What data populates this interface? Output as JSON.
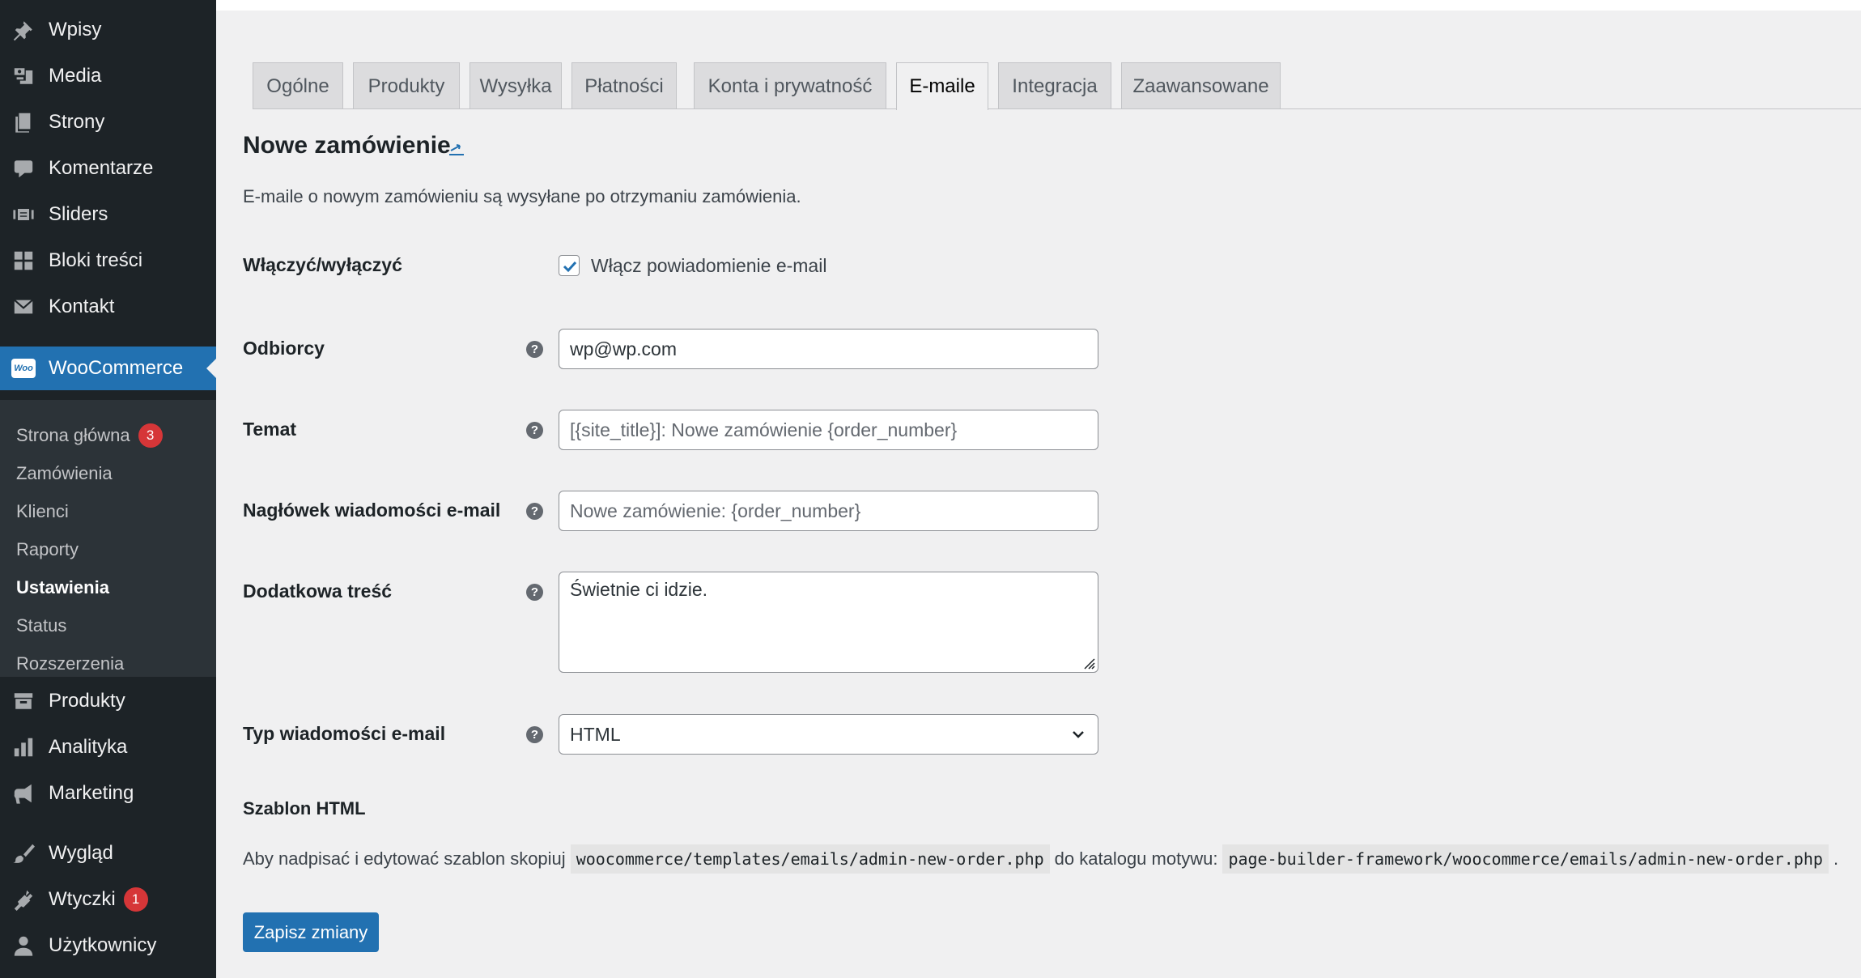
{
  "sidebar": {
    "top_items": [
      {
        "label": "Wpisy",
        "icon": "pin-icon"
      },
      {
        "label": "Media",
        "icon": "media-icon"
      },
      {
        "label": "Strony",
        "icon": "pages-icon"
      },
      {
        "label": "Komentarze",
        "icon": "comment-icon"
      },
      {
        "label": "Sliders",
        "icon": "slider-icon"
      },
      {
        "label": "Bloki treści",
        "icon": "blocks-icon"
      },
      {
        "label": "Kontakt",
        "icon": "mail-icon"
      }
    ],
    "woocommerce": {
      "label": "WooCommerce",
      "icon": "woocommerce-icon",
      "logo_text": "Woo"
    },
    "submenu": [
      {
        "label": "Strona główna",
        "badge": "3"
      },
      {
        "label": "Zamówienia"
      },
      {
        "label": "Klienci"
      },
      {
        "label": "Raporty"
      },
      {
        "label": "Ustawienia"
      },
      {
        "label": "Status"
      },
      {
        "label": "Rozszerzenia"
      }
    ],
    "bottom_items": [
      {
        "label": "Produkty",
        "icon": "archive-icon"
      },
      {
        "label": "Analityka",
        "icon": "bar-chart-icon"
      },
      {
        "label": "Marketing",
        "icon": "megaphone-icon"
      },
      {
        "label": "Wygląd",
        "icon": "brush-icon"
      },
      {
        "label": "Wtyczki",
        "icon": "plugin-icon",
        "badge": "1"
      },
      {
        "label": "Użytkownicy",
        "icon": "user-icon"
      }
    ]
  },
  "tabs": [
    {
      "label": "Ogólne"
    },
    {
      "label": "Produkty"
    },
    {
      "label": "Wysyłka"
    },
    {
      "label": "Płatności"
    },
    {
      "label": "Konta i prywatność"
    },
    {
      "label": "E-maile",
      "active": true
    },
    {
      "label": "Integracja"
    },
    {
      "label": "Zaawansowane"
    }
  ],
  "page": {
    "title": "Nowe zamówienie",
    "intro": "E-maile o nowym zamówieniu są wysyłane po otrzymaniu zamówienia."
  },
  "form": {
    "enable": {
      "label": "Włączyć/wyłączyć",
      "checkbox_label": "Włącz powiadomienie e-mail",
      "checked": true
    },
    "recipient": {
      "label": "Odbiorcy",
      "value": "wp@wp.com"
    },
    "subject": {
      "label": "Temat",
      "placeholder": "[{site_title}]: Nowe zamówienie {order_number}"
    },
    "heading": {
      "label": "Nagłówek wiadomości e-mail",
      "placeholder": "Nowe zamówienie: {order_number}"
    },
    "additional": {
      "label": "Dodatkowa treść",
      "value": "Świetnie ci idzie."
    },
    "email_type": {
      "label": "Typ wiadomości e-mail",
      "value": "HTML"
    }
  },
  "template": {
    "heading": "Szablon HTML",
    "text_before": "Aby nadpisać i edytować szablon skopiuj",
    "source_path": "woocommerce/templates/emails/admin-new-order.php",
    "text_middle": "do katalogu motywu:",
    "target_path": "page-builder-framework/woocommerce/emails/admin-new-order.php",
    "text_after": "."
  },
  "actions": {
    "save_label": "Zapisz zmiany"
  },
  "colors": {
    "accent": "#2271b1",
    "sidebar_bg": "#1d2327",
    "submenu_bg": "#2c3338",
    "badge": "#d63638",
    "page_bg": "#f0f0f1"
  }
}
